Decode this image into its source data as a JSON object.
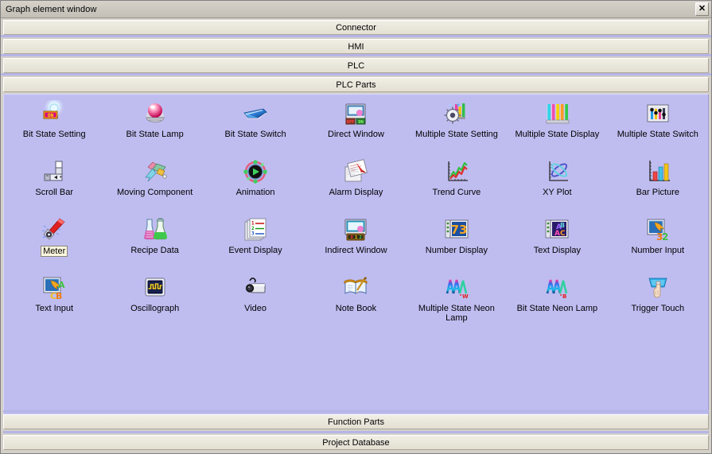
{
  "window": {
    "title": "Graph element window",
    "close_label": "✕"
  },
  "categories_top": [
    {
      "label": "Connector"
    },
    {
      "label": "HMI"
    },
    {
      "label": "PLC"
    },
    {
      "label": "PLC Parts"
    }
  ],
  "categories_bottom": [
    {
      "label": "Function Parts"
    },
    {
      "label": "Project Database"
    }
  ],
  "palette": {
    "background": "#bfbdf0",
    "bar_background": "#eae7dc",
    "titlebar_background": "#cbc7bf",
    "selected_label_background": "#fdf7e0"
  },
  "items": [
    {
      "label": "Bit State Setting",
      "icon": "bit-state-setting-icon",
      "selected": false
    },
    {
      "label": "Bit State Lamp",
      "icon": "bit-state-lamp-icon",
      "selected": false
    },
    {
      "label": "Bit State Switch",
      "icon": "bit-state-switch-icon",
      "selected": false
    },
    {
      "label": "Direct Window",
      "icon": "direct-window-icon",
      "selected": false
    },
    {
      "label": "Multiple State Setting",
      "icon": "multiple-state-setting-icon",
      "selected": false
    },
    {
      "label": "Multiple State Display",
      "icon": "multiple-state-display-icon",
      "selected": false
    },
    {
      "label": "Multiple State Switch",
      "icon": "multiple-state-switch-icon",
      "selected": false
    },
    {
      "label": "Scroll Bar",
      "icon": "scroll-bar-icon",
      "selected": false
    },
    {
      "label": "Moving Component",
      "icon": "moving-component-icon",
      "selected": false
    },
    {
      "label": "Animation",
      "icon": "animation-icon",
      "selected": false
    },
    {
      "label": "Alarm Display",
      "icon": "alarm-display-icon",
      "selected": false
    },
    {
      "label": "Trend Curve",
      "icon": "trend-curve-icon",
      "selected": false
    },
    {
      "label": "XY Plot",
      "icon": "xy-plot-icon",
      "selected": false
    },
    {
      "label": "Bar Picture",
      "icon": "bar-picture-icon",
      "selected": false
    },
    {
      "label": "Meter",
      "icon": "meter-icon",
      "selected": true
    },
    {
      "label": "Recipe Data",
      "icon": "recipe-data-icon",
      "selected": false
    },
    {
      "label": "Event Display",
      "icon": "event-display-icon",
      "selected": false
    },
    {
      "label": "Indirect Window",
      "icon": "indirect-window-icon",
      "selected": false
    },
    {
      "label": "Number Display",
      "icon": "number-display-icon",
      "selected": false
    },
    {
      "label": "Text Display",
      "icon": "text-display-icon",
      "selected": false
    },
    {
      "label": "Number Input",
      "icon": "number-input-icon",
      "selected": false
    },
    {
      "label": "Text Input",
      "icon": "text-input-icon",
      "selected": false
    },
    {
      "label": "Oscillograph",
      "icon": "oscillograph-icon",
      "selected": false
    },
    {
      "label": "Video",
      "icon": "video-icon",
      "selected": false
    },
    {
      "label": "Note Book",
      "icon": "note-book-icon",
      "selected": false
    },
    {
      "label": "Multiple State Neon Lamp",
      "icon": "multiple-state-neon-lamp-icon",
      "selected": false
    },
    {
      "label": "Bit State Neon Lamp",
      "icon": "bit-state-neon-lamp-icon",
      "selected": false
    },
    {
      "label": "Trigger Touch",
      "icon": "trigger-touch-icon",
      "selected": false
    }
  ]
}
